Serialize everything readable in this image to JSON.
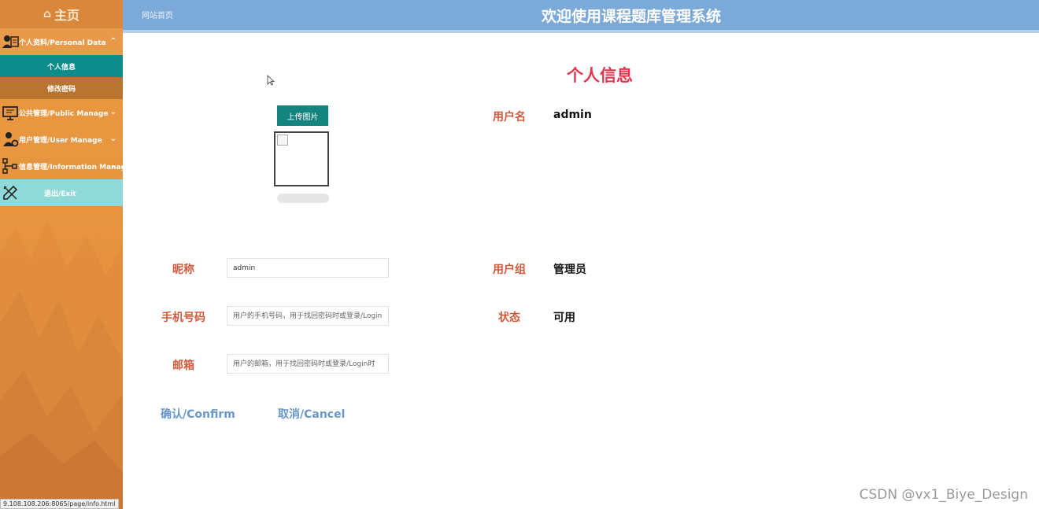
{
  "sidebar": {
    "home_label": "主页",
    "menu": [
      {
        "label": "个人资料/Personal Data",
        "icon": "user-card-icon",
        "chevron": "⌃"
      },
      {
        "label": "公共管理/Public Manage",
        "icon": "monitor-icon",
        "chevron": "⌄"
      },
      {
        "label": "用户管理/User Manage",
        "icon": "user-gear-icon",
        "chevron": "⌄"
      },
      {
        "label": "信息管理/Information Manage",
        "icon": "hierarchy-icon",
        "chevron": "⌄"
      }
    ],
    "sub_items": [
      {
        "label": "个人信息",
        "active": true
      },
      {
        "label": "修改密码",
        "active": false
      }
    ],
    "exit_label": "退出/Exit",
    "status_url": "9.108.108.206:8065/page/info.html"
  },
  "header": {
    "breadcrumb": "网站首页",
    "title": "欢迎使用课程题库管理系统"
  },
  "main": {
    "page_title": "个人信息",
    "upload_label": "上传图片",
    "username_label": "用户名",
    "username_value": "admin",
    "nickname_label": "昵称",
    "nickname_value": "admin",
    "phone_label": "手机号码",
    "phone_placeholder": "用户的手机号码，用于找回密码时或登录/Login",
    "email_label": "邮箱",
    "email_placeholder": "用户的邮箱，用于找回密码时或登录/Login时",
    "group_label": "用户组",
    "group_value": "管理员",
    "status_label": "状态",
    "status_value": "可用",
    "confirm_label": "确认/Confirm",
    "cancel_label": "取消/Cancel"
  },
  "watermark": "CSDN @vx1_Biye_Design",
  "colors": {
    "sidebar": "#e99a3f",
    "header": "#7ba9d8",
    "accent_teal": "#14857e",
    "label_red": "#d05a3c",
    "title_red": "#e0364f",
    "action_blue": "#6a97c9"
  }
}
